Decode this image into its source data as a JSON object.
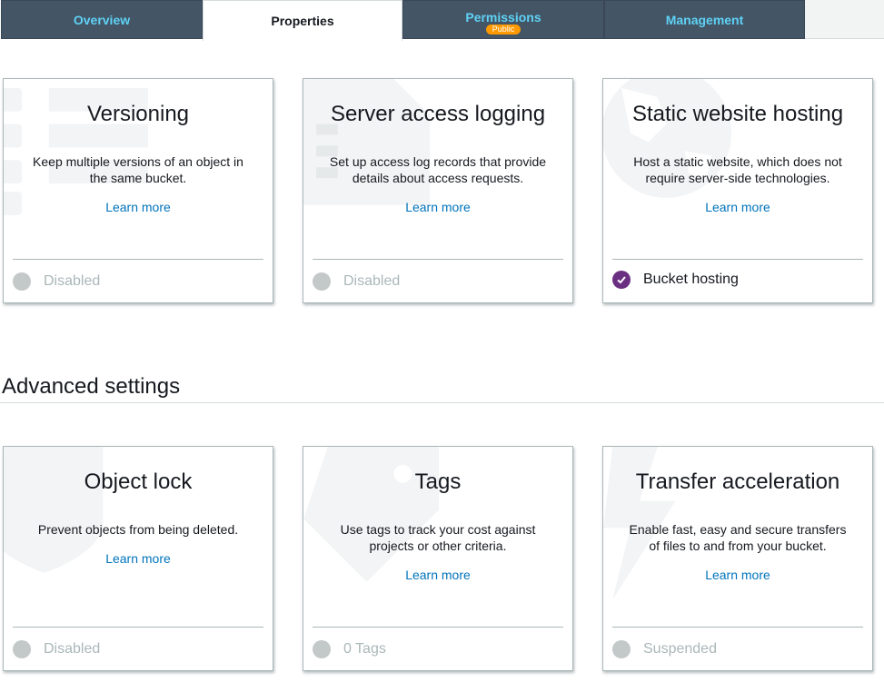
{
  "tabs": [
    {
      "label": "Overview"
    },
    {
      "label": "Properties"
    },
    {
      "label": "Permissions",
      "badge": "Public"
    },
    {
      "label": "Management"
    }
  ],
  "colors": {
    "tab_bg": "#445566",
    "tab_text": "#5fd2f5",
    "badge": "#ff9900",
    "link": "#0073bb",
    "enabled_check": "#6b2f81",
    "disabled_dot": "#c3c8c8"
  },
  "properties_cards": [
    {
      "title": "Versioning",
      "description": "Keep multiple versions of an object in the same bucket.",
      "link": "Learn more",
      "status": "Disabled",
      "enabled": false,
      "icon": "list-icon"
    },
    {
      "title": "Server access logging",
      "description": "Set up access log records that provide details about access requests.",
      "link": "Learn more",
      "status": "Disabled",
      "enabled": false,
      "icon": "log-icon"
    },
    {
      "title": "Static website hosting",
      "description": "Host a static website, which does not require server-side technologies.",
      "link": "Learn more",
      "status": "Bucket hosting",
      "enabled": true,
      "icon": "globe-icon"
    }
  ],
  "advanced": {
    "heading": "Advanced settings",
    "cards": [
      {
        "title": "Object lock",
        "description": "Prevent objects from being deleted.",
        "link": "Learn more",
        "status": "Disabled",
        "enabled": false,
        "icon": "shield-icon"
      },
      {
        "title": "Tags",
        "description": "Use tags to track your cost against projects or other criteria.",
        "link": "Learn more",
        "status": "0 Tags",
        "enabled": false,
        "icon": "tag-icon"
      },
      {
        "title": "Transfer acceleration",
        "description": "Enable fast, easy and secure transfers of files to and from your bucket.",
        "link": "Learn more",
        "status": "Suspended",
        "enabled": false,
        "icon": "lightning-icon"
      }
    ]
  }
}
